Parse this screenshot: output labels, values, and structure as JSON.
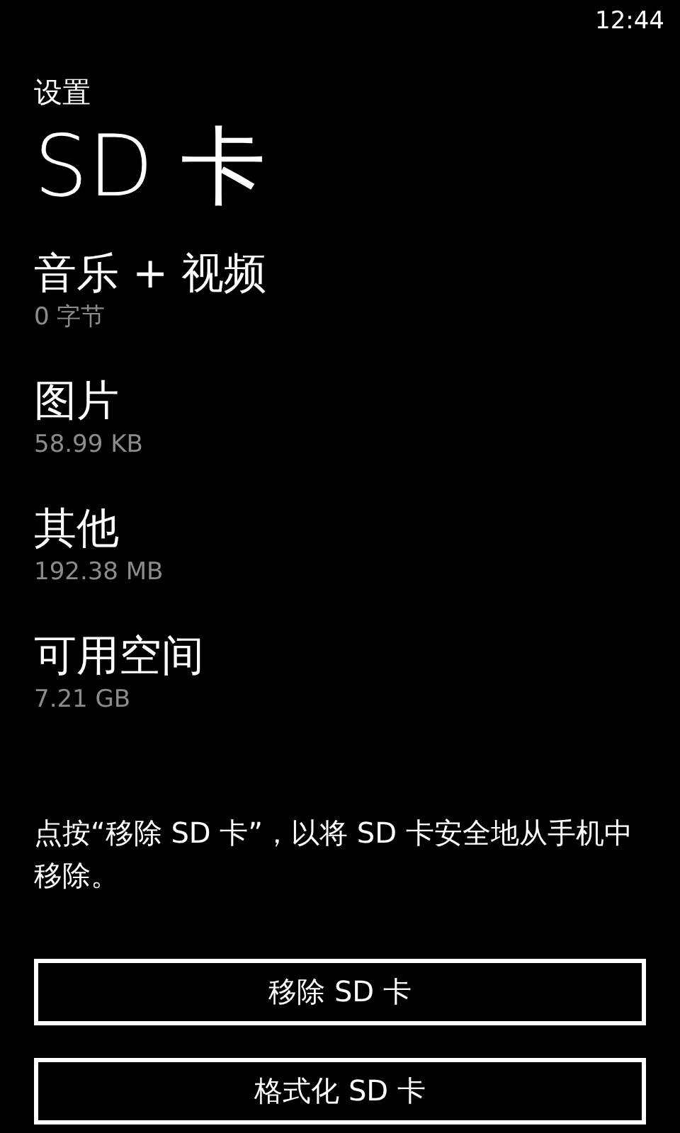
{
  "status_bar": {
    "time": "12:44"
  },
  "header": {
    "app_title": "设置",
    "page_title": "SD 卡"
  },
  "storage_items": [
    {
      "name": "音乐 + 视频",
      "size": "0 字节"
    },
    {
      "name": "图片",
      "size": "58.99 KB"
    },
    {
      "name": "其他",
      "size": "192.38 MB"
    },
    {
      "name": "可用空间",
      "size": "7.21 GB"
    }
  ],
  "note": "点按“移除 SD 卡”，以将 SD 卡安全地从手机中移除。",
  "buttons": [
    "移除 SD 卡",
    "格式化 SD 卡"
  ]
}
